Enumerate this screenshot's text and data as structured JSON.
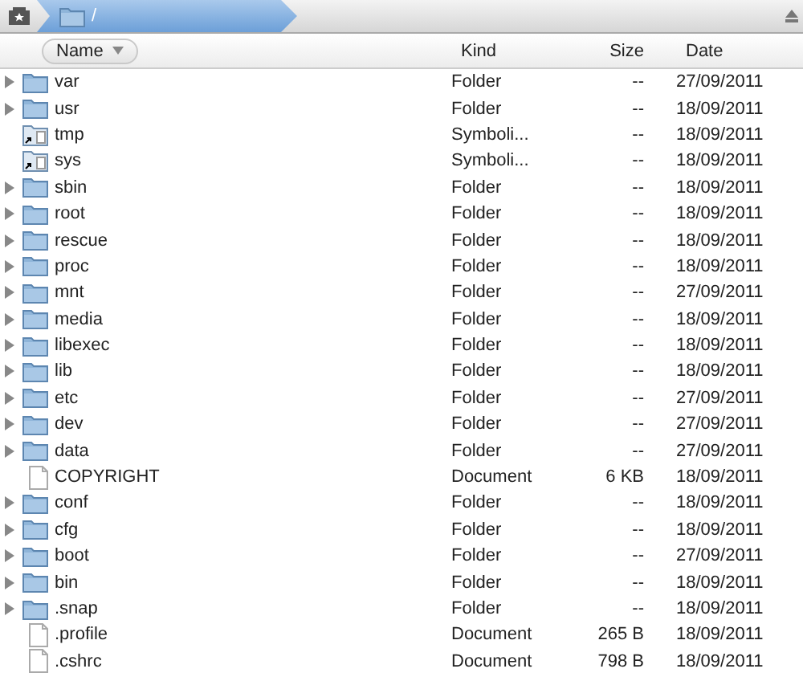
{
  "path_bar": {
    "segments": [
      {
        "label": "/",
        "selected": true
      }
    ]
  },
  "table": {
    "columns": [
      {
        "label": "Name",
        "selected": true
      },
      {
        "label": "Kind",
        "selected": false
      },
      {
        "label": "Size",
        "selected": false
      },
      {
        "label": "Date",
        "selected": false
      }
    ],
    "rows": [
      {
        "kind": "folder",
        "name": "var",
        "type": "Folder",
        "size": "--",
        "date": "27/09/2011"
      },
      {
        "kind": "folder",
        "name": "usr",
        "type": "Folder",
        "size": "--",
        "date": "18/09/2011"
      },
      {
        "kind": "symlink",
        "name": "tmp",
        "type": "Symboli...",
        "size": "--",
        "date": "18/09/2011"
      },
      {
        "kind": "symlink",
        "name": "sys",
        "type": "Symboli...",
        "size": "--",
        "date": "18/09/2011"
      },
      {
        "kind": "folder",
        "name": "sbin",
        "type": "Folder",
        "size": "--",
        "date": "18/09/2011"
      },
      {
        "kind": "folder",
        "name": "root",
        "type": "Folder",
        "size": "--",
        "date": "18/09/2011"
      },
      {
        "kind": "folder",
        "name": "rescue",
        "type": "Folder",
        "size": "--",
        "date": "18/09/2011"
      },
      {
        "kind": "folder",
        "name": "proc",
        "type": "Folder",
        "size": "--",
        "date": "18/09/2011"
      },
      {
        "kind": "folder",
        "name": "mnt",
        "type": "Folder",
        "size": "--",
        "date": "27/09/2011"
      },
      {
        "kind": "folder",
        "name": "media",
        "type": "Folder",
        "size": "--",
        "date": "18/09/2011"
      },
      {
        "kind": "folder",
        "name": "libexec",
        "type": "Folder",
        "size": "--",
        "date": "18/09/2011"
      },
      {
        "kind": "folder",
        "name": "lib",
        "type": "Folder",
        "size": "--",
        "date": "18/09/2011"
      },
      {
        "kind": "folder",
        "name": "etc",
        "type": "Folder",
        "size": "--",
        "date": "27/09/2011"
      },
      {
        "kind": "folder",
        "name": "dev",
        "type": "Folder",
        "size": "--",
        "date": "27/09/2011"
      },
      {
        "kind": "folder",
        "name": "data",
        "type": "Folder",
        "size": "--",
        "date": "27/09/2011"
      },
      {
        "kind": "document",
        "name": "COPYRIGHT",
        "type": "Document",
        "size": "6 KB",
        "date": "18/09/2011"
      },
      {
        "kind": "folder",
        "name": "conf",
        "type": "Folder",
        "size": "--",
        "date": "18/09/2011"
      },
      {
        "kind": "folder",
        "name": "cfg",
        "type": "Folder",
        "size": "--",
        "date": "18/09/2011"
      },
      {
        "kind": "folder",
        "name": "boot",
        "type": "Folder",
        "size": "--",
        "date": "27/09/2011"
      },
      {
        "kind": "folder",
        "name": "bin",
        "type": "Folder",
        "size": "--",
        "date": "18/09/2011"
      },
      {
        "kind": "folder",
        "name": ".snap",
        "type": "Folder",
        "size": "--",
        "date": "18/09/2011"
      },
      {
        "kind": "document",
        "name": ".profile",
        "type": "Document",
        "size": "265 B",
        "date": "18/09/2011"
      },
      {
        "kind": "document",
        "name": ".cshrc",
        "type": "Document",
        "size": "798 B",
        "date": "18/09/2011"
      }
    ]
  }
}
